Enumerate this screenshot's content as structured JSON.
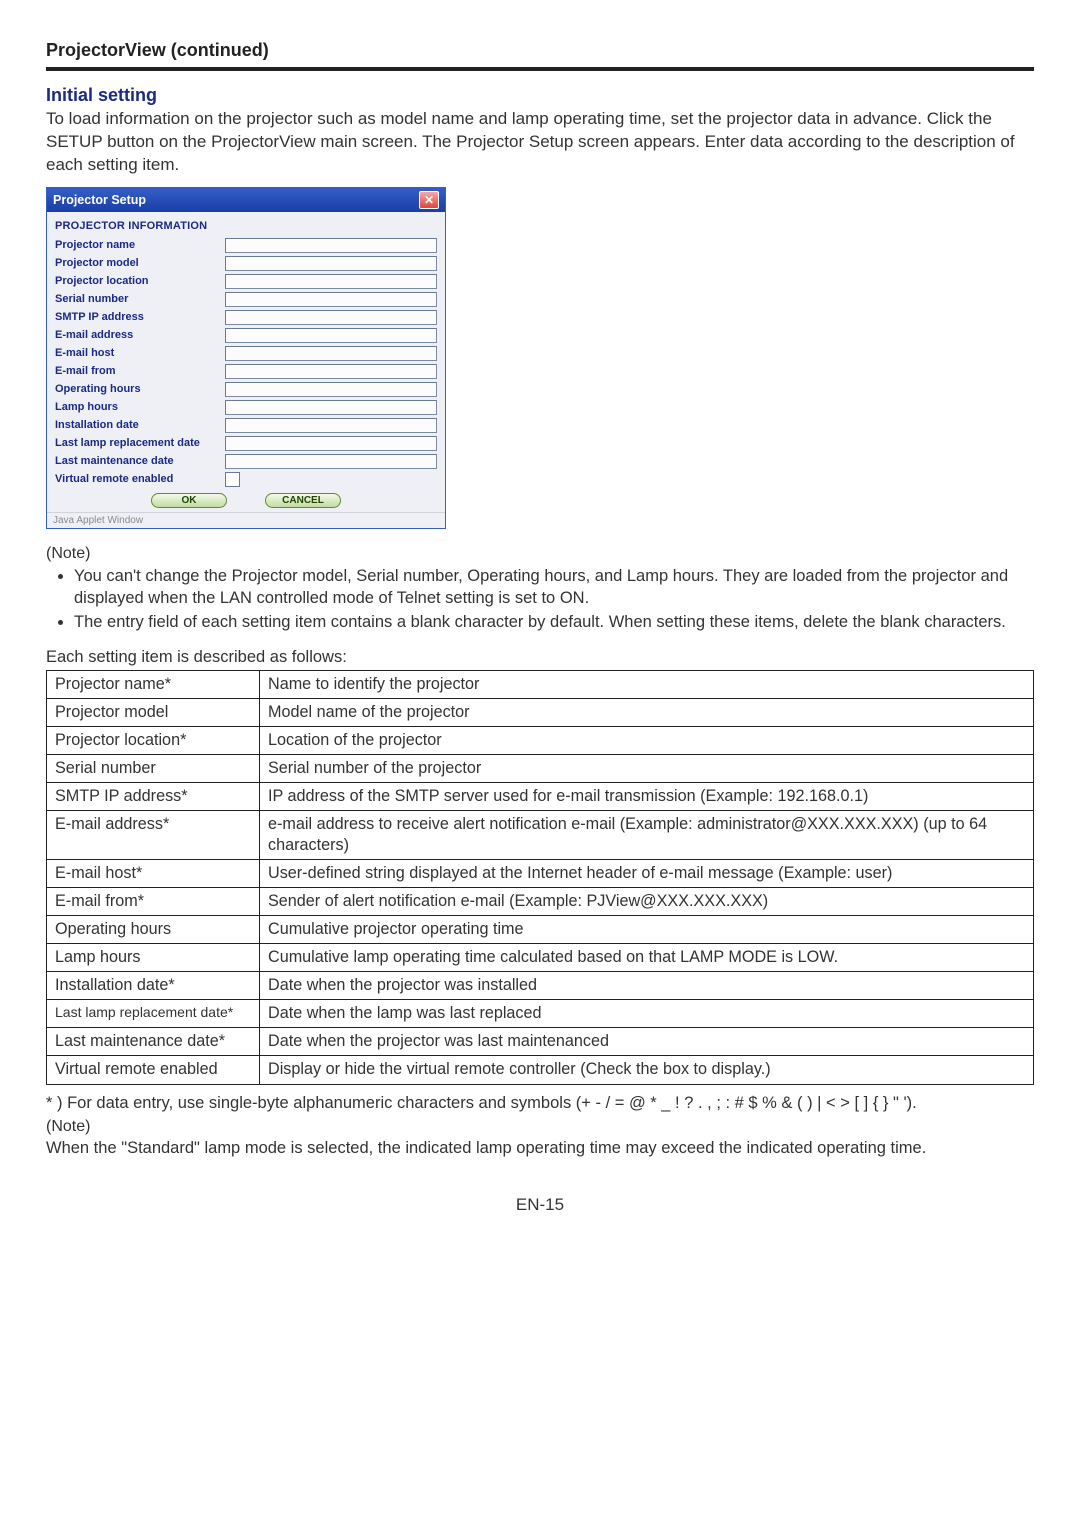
{
  "page": {
    "title": "ProjectorView (continued)",
    "section_heading": "Initial setting",
    "intro": "To load information on the projector such as model name and lamp operating time, set the projector data in advance. Click the SETUP button on the ProjectorView main screen. The Projector Setup screen appears. Enter data according to the description of each setting item.",
    "note_label": "(Note)",
    "notes": [
      "You can't change the Projector model, Serial number, Operating hours, and Lamp hours. They are loaded from the projector and displayed when the LAN controlled mode of Telnet setting is set to ON.",
      "The entry field of each setting item contains a blank character by default. When setting these items, delete the blank characters."
    ],
    "table_intro": "Each setting item is described as follows:",
    "footnote_symbols": "* ) For data entry, use single-byte alphanumeric characters and symbols (+ - / = @ * _ ! ? . , ; : # $ % & ( ) | < > [ ] { } \" ').",
    "note2_label": "(Note)",
    "note2_text": "When the \"Standard\" lamp mode is selected, the indicated lamp operating time may exceed the indicated operating time.",
    "page_number": "EN-15"
  },
  "dialog": {
    "title": "Projector Setup",
    "section_head": "PROJECTOR INFORMATION",
    "labels": [
      "Projector name",
      "Projector model",
      "Projector location",
      "Serial number",
      "SMTP IP address",
      "E-mail address",
      "E-mail host",
      "E-mail from",
      "Operating hours",
      "Lamp hours",
      "Installation date",
      "Last lamp replacement date",
      "Last maintenance date",
      "Virtual remote enabled"
    ],
    "ok": "OK",
    "cancel": "CANCEL",
    "footer": "Java Applet Window"
  },
  "table": {
    "rows": [
      {
        "item": "Projector name*",
        "desc": "Name to identify the projector"
      },
      {
        "item": "Projector model",
        "desc": "Model name of the projector"
      },
      {
        "item": "Projector location*",
        "desc": "Location of the projector"
      },
      {
        "item": "Serial number",
        "desc": "Serial number of the projector"
      },
      {
        "item": "SMTP IP address*",
        "desc": "IP address of the SMTP server used for e-mail transmission (Example: 192.168.0.1)"
      },
      {
        "item": "E-mail address*",
        "desc": "e-mail address to receive alert notification e-mail (Example: administrator@XXX.XXX.XXX) (up to 64 characters)"
      },
      {
        "item": "E-mail host*",
        "desc": "User-defined string displayed at the Internet header of e-mail message (Example: user)"
      },
      {
        "item": "E-mail from*",
        "desc": "Sender of alert notification e-mail (Example: PJView@XXX.XXX.XXX)"
      },
      {
        "item": "Operating hours",
        "desc": "Cumulative projector operating time"
      },
      {
        "item": "Lamp hours",
        "desc": "Cumulative lamp operating time calculated based on that LAMP MODE is LOW."
      },
      {
        "item": "Installation date*",
        "desc": "Date when the projector was installed"
      },
      {
        "item": "Last lamp replacement date*",
        "desc": "Date when the lamp was last replaced"
      },
      {
        "item": "Last maintenance date*",
        "desc": "Date when the projector was last maintenanced"
      },
      {
        "item": "Virtual remote enabled",
        "desc": "Display or hide the virtual remote controller (Check the box to display.)"
      }
    ]
  }
}
